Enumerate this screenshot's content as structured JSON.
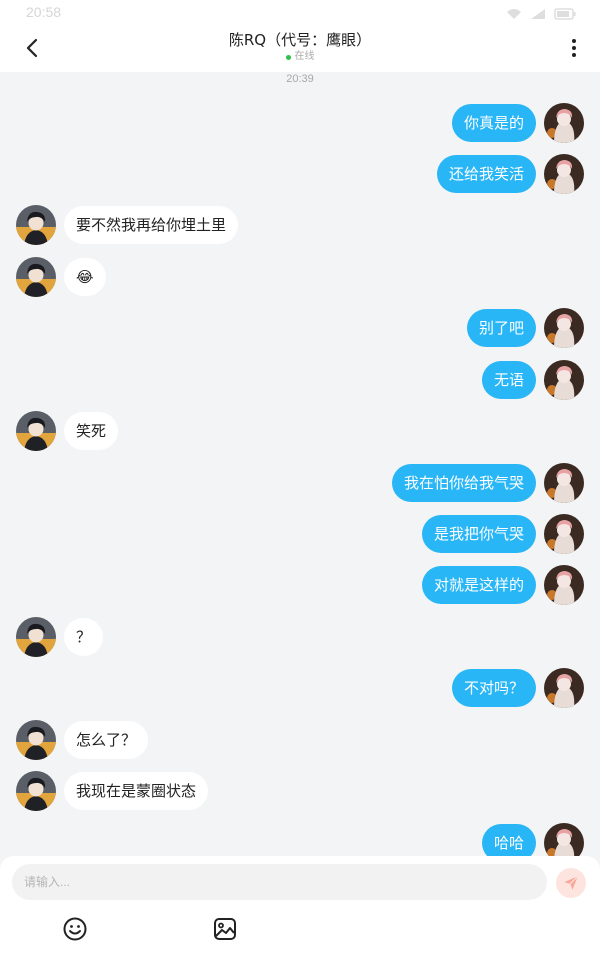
{
  "status_bar": {
    "time": "20:58"
  },
  "header": {
    "title": "陈RQ（代号：鹰眼）",
    "online_text": "在线"
  },
  "chat": {
    "timestamp": "20:39",
    "messages": [
      {
        "side": "out",
        "text": "你真是的"
      },
      {
        "side": "out",
        "text": "还给我笑活"
      },
      {
        "side": "in",
        "text": "要不然我再给你埋土里"
      },
      {
        "side": "in",
        "text": "😂"
      },
      {
        "side": "out",
        "text": "别了吧"
      },
      {
        "side": "out",
        "text": "无语"
      },
      {
        "side": "in",
        "text": "笑死"
      },
      {
        "side": "out",
        "text": "我在怕你给我气哭"
      },
      {
        "side": "out",
        "text": "是我把你气哭"
      },
      {
        "side": "out",
        "text": "对就是这样的"
      },
      {
        "side": "in",
        "text": "？"
      },
      {
        "side": "out",
        "text": "不对吗？"
      },
      {
        "side": "in",
        "text": "怎么了？"
      },
      {
        "side": "in",
        "text": "我现在是蒙圈状态"
      },
      {
        "side": "out",
        "text": "哈哈"
      }
    ]
  },
  "input": {
    "placeholder": "请输入...",
    "value": ""
  },
  "icons": {
    "back": "chevron-left-icon",
    "more": "more-vertical-icon",
    "send": "send-icon",
    "emoji": "emoji-icon",
    "image": "image-icon"
  },
  "colors": {
    "outgoing_bubble": "#29b6f6",
    "incoming_bubble": "#ffffff",
    "online_dot": "#2fbf4a",
    "background": "#f3f4f6"
  }
}
